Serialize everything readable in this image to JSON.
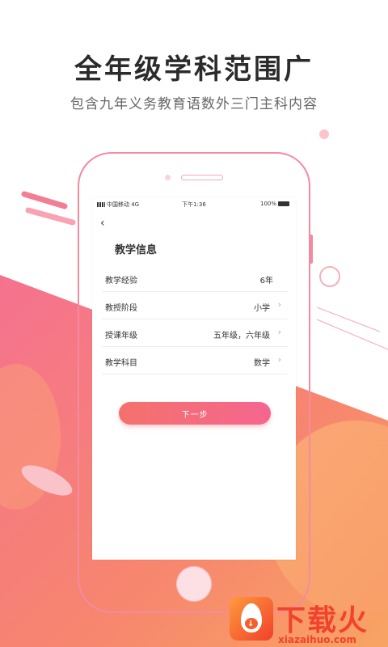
{
  "headline": "全年级学科范围广",
  "subline": "包含九年义务教育语数外三门主科内容",
  "status_bar": {
    "carrier": "中国移动 4G",
    "time": "下午1:36",
    "battery": "100%"
  },
  "screen": {
    "back_icon": "‹",
    "title": "教学信息",
    "rows": [
      {
        "label": "教学经验",
        "value": "6年",
        "has_chevron": false
      },
      {
        "label": "教授阶段",
        "value": "小学",
        "has_chevron": true
      },
      {
        "label": "授课年级",
        "value": "五年级，六年级",
        "has_chevron": true
      },
      {
        "label": "教学科目",
        "value": "数学",
        "has_chevron": true
      }
    ],
    "chevron": "›",
    "next_button": "下一步"
  },
  "brand": {
    "name": "下载火",
    "url": "xiazaihuo.com",
    "logo_arrow": "↓"
  },
  "colors": {
    "accent_pink": "#f5668f",
    "accent_coral": "#f5716c",
    "brand_red": "#f0422c",
    "phone_outline": "#f48aa0"
  }
}
